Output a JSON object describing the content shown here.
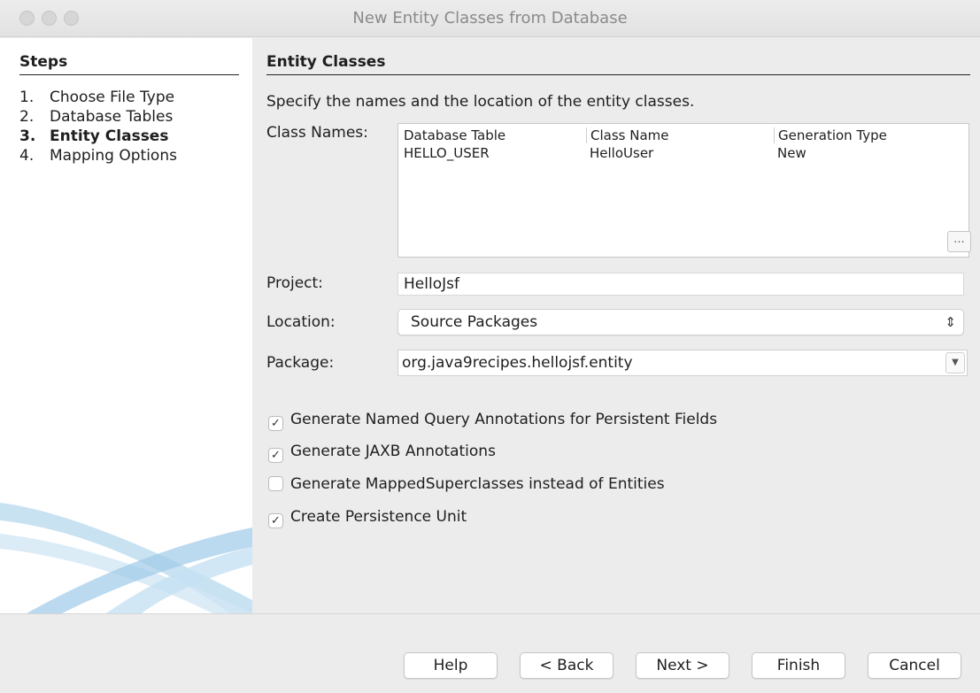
{
  "window": {
    "title": "New Entity Classes from Database"
  },
  "steps": {
    "heading": "Steps",
    "items": [
      {
        "num": "1.",
        "label": "Choose File Type",
        "active": false
      },
      {
        "num": "2.",
        "label": "Database Tables",
        "active": false
      },
      {
        "num": "3.",
        "label": "Entity Classes",
        "active": true
      },
      {
        "num": "4.",
        "label": "Mapping Options",
        "active": false
      }
    ]
  },
  "main": {
    "section_title": "Entity Classes",
    "description": "Specify the names and the location of the entity classes.",
    "class_names_label": "Class Names:",
    "table": {
      "columns": [
        "Database Table",
        "Class Name",
        "Generation Type"
      ],
      "rows": [
        [
          "HELLO_USER",
          "HelloUser",
          "New"
        ]
      ]
    },
    "ellipsis_label": "...",
    "project_label": "Project:",
    "project_value": "HelloJsf",
    "location_label": "Location:",
    "location_value": "Source Packages",
    "package_label": "Package:",
    "package_value": "org.java9recipes.hellojsf.entity",
    "options": [
      {
        "label": "Generate Named Query Annotations for Persistent Fields",
        "checked": true
      },
      {
        "label": "Generate JAXB Annotations",
        "checked": true
      },
      {
        "label": "Generate MappedSuperclasses instead of Entities",
        "checked": false
      },
      {
        "label": "Create Persistence Unit",
        "checked": true
      }
    ]
  },
  "footer": {
    "help": "Help",
    "back": "< Back",
    "next": "Next >",
    "finish": "Finish",
    "cancel": "Cancel"
  }
}
